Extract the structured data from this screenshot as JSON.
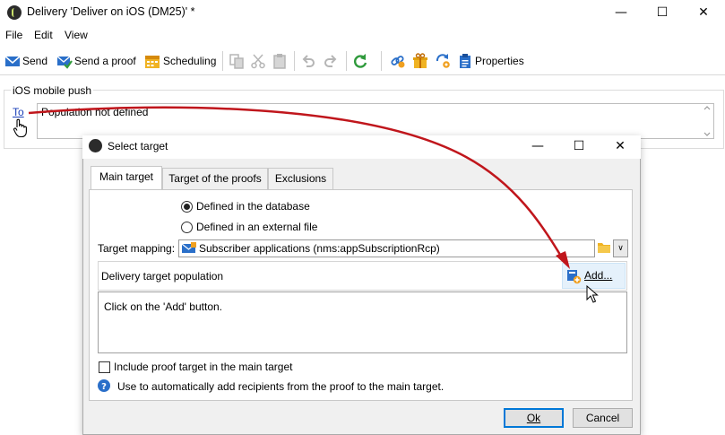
{
  "window": {
    "title": "Delivery 'Deliver on iOS (DM25)' *",
    "minimize_icon": "minimize-icon",
    "maximize_icon": "maximize-icon",
    "close_icon": "close-icon"
  },
  "menu": {
    "items": [
      "File",
      "Edit",
      "View"
    ]
  },
  "toolbar": {
    "send": "Send",
    "send_proof": "Send a proof",
    "scheduling": "Scheduling",
    "properties": "Properties",
    "icons": [
      "copy-icon",
      "cut-icon",
      "paste-icon",
      "undo-icon",
      "redo-icon",
      "refresh-icon",
      "link-icon",
      "gift-icon",
      "sync-icon",
      "clipboard-icon"
    ]
  },
  "group": {
    "label": "iOS mobile push",
    "to_link": "To",
    "to_value": "Population not defined"
  },
  "dialog": {
    "title": "Select target",
    "tabs": [
      "Main target",
      "Target of the proofs",
      "Exclusions"
    ],
    "active_tab": "Main target",
    "radio_database": "Defined in the database",
    "radio_external": "Defined in an external file",
    "selected_radio": "Defined in the database",
    "mapping_label": "Target mapping:",
    "mapping_value": "Subscriber applications (nms:appSubscriptionRcp)",
    "population_label": "Delivery target population",
    "add_button": "Add...",
    "body_text": "Click on the 'Add' button.",
    "include_proof": "Include proof target in the main target",
    "include_proof_checked": false,
    "help_text": "Use to automatically add recipients from the proof to the main target.",
    "ok": "Ok",
    "cancel": "Cancel"
  },
  "colors": {
    "link": "#1a3fb8",
    "accent": "#0078d7",
    "arrow": "#c0161c",
    "add_highlight": "#e5f1fb"
  }
}
